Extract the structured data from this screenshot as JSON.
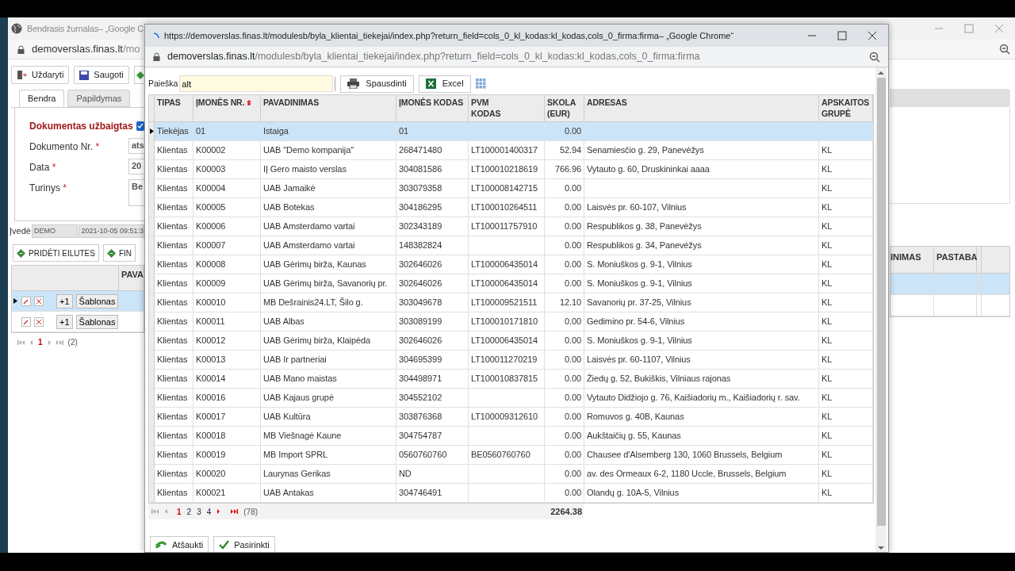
{
  "background_window": {
    "title": "Bendrasis žurnalas– „Google C",
    "address": {
      "host": "demoverslas.finas.lt",
      "path": "/mo"
    },
    "toolbar": [
      "Uždaryti",
      "Saugoti"
    ],
    "tabs": [
      {
        "label": "Bendra",
        "selected": true
      },
      {
        "label": "Papildymas",
        "selected": false
      }
    ],
    "form": {
      "completed_label": "Dokumentas užbaigtas",
      "completed": true,
      "fields": [
        {
          "label": "Dokumento Nr.",
          "required_mark": "*",
          "value": "ats"
        },
        {
          "label": "Data",
          "required_mark": "*",
          "value": "20"
        },
        {
          "label": "Turinys",
          "required_mark": "*",
          "value": "Be"
        }
      ]
    },
    "entered_by": {
      "label": "Įvedė",
      "user": "DEMO",
      "time": "2021-10-05 09:51:3"
    },
    "actions": [
      "PRIDĖTI EILUTES",
      "FIN"
    ],
    "lines": {
      "columns": [
        "PAVA",
        "INIMAS",
        "PASTABA"
      ],
      "rows": [
        {
          "selected": true,
          "add": "+1",
          "template": "Šablonas"
        },
        {
          "selected": false,
          "add": "+1",
          "template": "Šablonas"
        }
      ]
    },
    "pager": {
      "current": "1",
      "count": "(2)"
    }
  },
  "popup": {
    "title": "https://demoverslas.finas.lt/modulesb/byla_klientai_tiekejai/index.php?return_field=cols_0_kl_kodas:kl_kodas,cols_0_firma:firma– „Google Chrome“",
    "address": {
      "host": "demoverslas.finas.lt",
      "path": "/modulesb/byla_klientai_tiekejai/index.php?return_field=cols_0_kl_kodas:kl_kodas,cols_0_firma:firma"
    },
    "search": {
      "label": "Paieška",
      "value": "alt"
    },
    "buttons": [
      "Spausdinti",
      "Excel"
    ],
    "table": {
      "columns": [
        {
          "label": "TIPAS"
        },
        {
          "label": "ĮMONĖS NR.",
          "sorted": true
        },
        {
          "label": "PAVADINIMAS"
        },
        {
          "label": "ĮMONĖS KODAS"
        },
        {
          "label": "PVM KODAS"
        },
        {
          "label": "SKOLA (EUR)"
        },
        {
          "label": "ADRESAS"
        },
        {
          "label": "APSKAITOS GRUPĖ"
        }
      ],
      "rows": [
        {
          "selected": true,
          "cells": [
            "Tiekėjas",
            "01",
            "Istaiga",
            "01",
            "",
            "0.00",
            "",
            ""
          ]
        },
        {
          "selected": false,
          "cells": [
            "Klientas",
            "K00002",
            "UAB \"Demo kompanija\"",
            "268471480",
            "LT100001400317",
            "52.94",
            "Senamiesčio g. 29, Panevėžys",
            "KL"
          ]
        },
        {
          "selected": false,
          "cells": [
            "Klientas",
            "K00003",
            "IĮ Gero maisto verslas",
            "304081586",
            "LT100010218619",
            "766.96",
            "Vytauto g. 60, Druskininkai aaaa",
            "KL"
          ]
        },
        {
          "selected": false,
          "cells": [
            "Klientas",
            "K00004",
            "UAB Jamaikė",
            "303079358",
            "LT100008142715",
            "0.00",
            "",
            "KL"
          ]
        },
        {
          "selected": false,
          "cells": [
            "Klientas",
            "K00005",
            "UAB Botekas",
            "304186295",
            "LT100010264511",
            "0.00",
            "Laisvės pr. 60-107, Vilnius",
            "KL"
          ]
        },
        {
          "selected": false,
          "cells": [
            "Klientas",
            "K00006",
            "UAB Amsterdamo vartai",
            "302343189",
            "LT100011757910",
            "0.00",
            "Respublikos g. 38, Panevėžys",
            "KL"
          ]
        },
        {
          "selected": false,
          "cells": [
            "Klientas",
            "K00007",
            "UAB Amsterdamo vartai",
            "148382824",
            "",
            "0.00",
            "Respublikos g. 34, Panevėžys",
            "KL"
          ]
        },
        {
          "selected": false,
          "cells": [
            "Klientas",
            "K00008",
            "UAB Gėrimų birža, Kaunas",
            "302646026",
            "LT100006435014",
            "0.00",
            "S. Moniuškos g. 9-1, Vilnius",
            "KL"
          ]
        },
        {
          "selected": false,
          "cells": [
            "Klientas",
            "K00009",
            "UAB Gėrimų birža, Savanorių pr.",
            "302646026",
            "LT100006435014",
            "0.00",
            "S. Moniuškos g. 9-1, Vilnius",
            "KL"
          ]
        },
        {
          "selected": false,
          "cells": [
            "Klientas",
            "K00010",
            "MB Dešrainis24.LT, Šilo g.",
            "303049678",
            "LT100009521511",
            "12.10",
            "Savanorių pr. 37-25, Vilnius",
            "KL"
          ]
        },
        {
          "selected": false,
          "cells": [
            "Klientas",
            "K00011",
            "UAB Albas",
            "303089199",
            "LT100010171810",
            "0.00",
            "Gedimino pr. 54-6, Vilnius",
            "KL"
          ]
        },
        {
          "selected": false,
          "cells": [
            "Klientas",
            "K00012",
            "UAB Gėrimų birža, Klaipėda",
            "302646026",
            "LT100006435014",
            "0.00",
            "S. Moniuškos g. 9-1, Vilnius",
            "KL"
          ]
        },
        {
          "selected": false,
          "cells": [
            "Klientas",
            "K00013",
            "UAB Ir partneriai",
            "304695399",
            "LT100011270219",
            "0.00",
            "Laisvės pr. 60-1107, Vilnius",
            "KL"
          ]
        },
        {
          "selected": false,
          "cells": [
            "Klientas",
            "K00014",
            "UAB Mano maistas",
            "304498971",
            "LT100010837815",
            "0.00",
            "Žiedų g. 52, Bukiškis, Vilniaus rajonas",
            "KL"
          ]
        },
        {
          "selected": false,
          "cells": [
            "Klientas",
            "K00016",
            "UAB Kajaus grupė",
            "304552102",
            "",
            "0.00",
            "Vytauto Didžiojo g. 76, Kaišiadorių m., Kaišiadorių r. sav.",
            "KL"
          ]
        },
        {
          "selected": false,
          "cells": [
            "Klientas",
            "K00017",
            "UAB Kultūra",
            "303876368",
            "LT100009312610",
            "0.00",
            "Romuvos g. 40B, Kaunas",
            "KL"
          ]
        },
        {
          "selected": false,
          "cells": [
            "Klientas",
            "K00018",
            "MB Viešnagė Kaune",
            "304754787",
            "",
            "0.00",
            "Aukštaičių g. 55, Kaunas",
            "KL"
          ]
        },
        {
          "selected": false,
          "cells": [
            "Klientas",
            "K00019",
            "MB Import SPRL",
            "0560760760",
            "BE0560760760",
            "0.00",
            "Chausee d'Alsemberg 130, 1060 Brussels, Belgium",
            "KL"
          ]
        },
        {
          "selected": false,
          "cells": [
            "Klientas",
            "K00020",
            "Laurynas Gerikas",
            "ND",
            "",
            "0.00",
            "av. des Ormeaux 6-2, 1180 Uccle, Brussels, Belgium",
            "KL"
          ]
        },
        {
          "selected": false,
          "cells": [
            "Klientas",
            "K00021",
            "UAB Antakas",
            "304746491",
            "",
            "0.00",
            "Olandų g. 10A-5, Vilnius",
            "KL"
          ]
        }
      ]
    },
    "pager": {
      "pages": [
        {
          "label": "1",
          "selected": true
        },
        {
          "label": "2",
          "selected": false
        },
        {
          "label": "3",
          "selected": false
        },
        {
          "label": "4",
          "selected": false
        }
      ],
      "count": "(78)",
      "total": "2264.38"
    },
    "actions": [
      "Atšaukti",
      "Pasirinkti"
    ]
  }
}
